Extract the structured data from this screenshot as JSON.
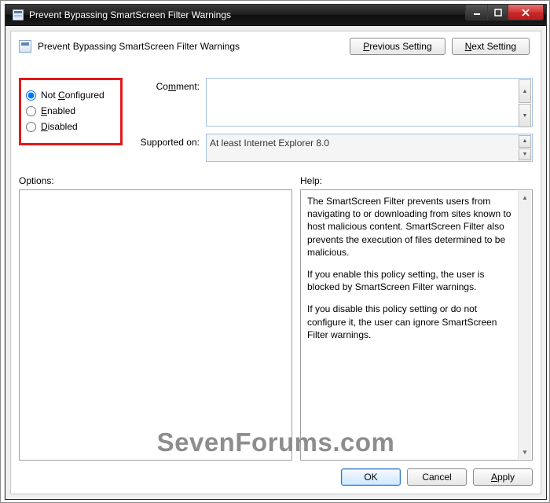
{
  "window": {
    "title": "Prevent Bypassing SmartScreen Filter Warnings"
  },
  "header": {
    "policy_title": "Prevent Bypassing SmartScreen Filter Warnings",
    "prev_label_pre": "",
    "prev_hotkey": "P",
    "prev_label_post": "revious Setting",
    "next_label_pre": "",
    "next_hotkey": "N",
    "next_label_post": "ext Setting"
  },
  "state": {
    "radios": {
      "not_configured": {
        "pre": "Not ",
        "hotkey": "C",
        "post": "onfigured",
        "checked": true
      },
      "enabled": {
        "pre": "",
        "hotkey": "E",
        "post": "nabled",
        "checked": false
      },
      "disabled": {
        "pre": "",
        "hotkey": "D",
        "post": "isabled",
        "checked": false
      }
    },
    "comment_label_pre": "Co",
    "comment_hotkey": "m",
    "comment_label_post": "ment:",
    "comment_value": "",
    "supported_label": "Supported on:",
    "supported_value": "At least Internet Explorer 8.0"
  },
  "panes": {
    "options_label": "Options:",
    "help_label": "Help:",
    "help_paragraphs": [
      "The SmartScreen Filter prevents users from navigating to or downloading from sites known to host malicious content. SmartScreen Filter also prevents the execution of files determined to be malicious.",
      "If you enable this policy setting, the user is blocked by SmartScreen Filter warnings.",
      "If you disable this policy setting or do not configure it, the user can ignore SmartScreen Filter warnings."
    ]
  },
  "footer": {
    "ok": "OK",
    "cancel": "Cancel",
    "apply_pre": "",
    "apply_hotkey": "A",
    "apply_post": "pply"
  },
  "watermark": "SevenForums.com"
}
